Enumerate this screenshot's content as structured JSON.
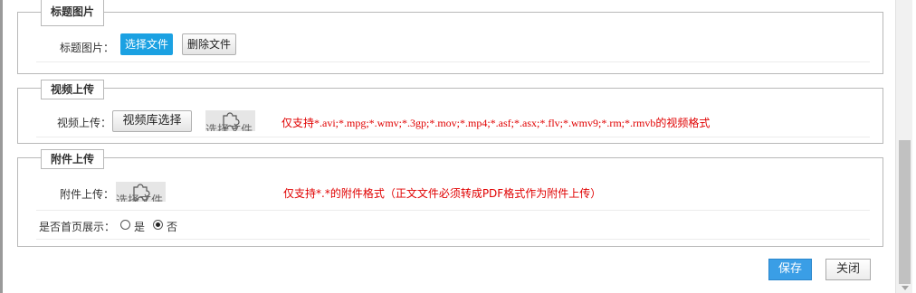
{
  "title_image": {
    "legend": "标题图片",
    "field_label": "标题图片：",
    "select_button": "选择文件",
    "delete_button": "删除文件"
  },
  "video_upload": {
    "legend": "视频上传",
    "field_label": "视频上传：",
    "library_button": "视频库选择",
    "plugin_text": "选择文件",
    "hint": "仅支持*.avi;*.mpg;*.wmv;*.3gp;*.mov;*.mp4;*.asf;*.asx;*.flv;*.wmv9;*.rm;*.rmvb的视频格式"
  },
  "attachment_upload": {
    "legend": "附件上传",
    "field_label": "附件上传：",
    "plugin_text": "选择文件",
    "hint": "仅支持*.*的附件格式（正文文件必须转成PDF格式作为附件上传）",
    "homepage_label": "是否首页展示：",
    "option_yes": "是",
    "option_no": "否",
    "selected": "否"
  },
  "actions": {
    "save": "保存",
    "close": "关闭"
  },
  "colors": {
    "primary_button": "#1ba1e2",
    "save_button": "#3a9ee6",
    "hint_text": "#e00000"
  },
  "icons": {
    "plugin": "puzzle-piece-icon"
  }
}
